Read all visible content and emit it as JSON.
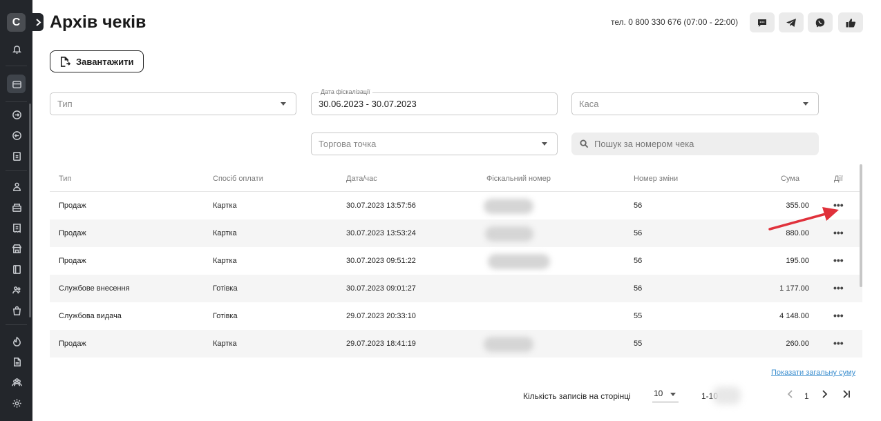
{
  "sidebar": {
    "logo": "C",
    "items": [
      "bell-icon",
      "card-icon",
      "login-icon",
      "logout-icon",
      "report-icon",
      "users-icon",
      "cashbox-icon",
      "receipt-icon",
      "store-icon",
      "book-icon",
      "people-icon",
      "bag-icon",
      "fire-icon",
      "document-icon",
      "team-icon",
      "gear-icon"
    ]
  },
  "header": {
    "title": "Архів чеків",
    "phone": "тел. 0 800 330 676 (07:00 - 22:00)",
    "buttons": [
      "chat-icon",
      "telegram-icon",
      "viber-icon",
      "thumbs-up-icon"
    ]
  },
  "toolbar": {
    "download_label": "Завантажити"
  },
  "filters": {
    "type_placeholder": "Тип",
    "date_label": "Дата фіскалізації",
    "date_value": "30.06.2023 - 30.07.2023",
    "cashbox_placeholder": "Каса",
    "outlet_placeholder": "Торгова точка",
    "search_placeholder": "Пошук за номером чека"
  },
  "table": {
    "columns": {
      "type": "Тип",
      "payment": "Спосіб оплати",
      "datetime": "Дата/час",
      "fiscal": "Фіскальний номер",
      "shift": "Номер зміни",
      "sum": "Сума",
      "actions": "Дії"
    },
    "rows": [
      {
        "type": "Продаж",
        "payment": "Картка",
        "datetime": "30.07.2023 13:57:56",
        "shift": "56",
        "sum": "355.00",
        "actions": "•••"
      },
      {
        "type": "Продаж",
        "payment": "Картка",
        "datetime": "30.07.2023 13:53:24",
        "shift": "56",
        "sum": "880.00",
        "actions": "•••"
      },
      {
        "type": "Продаж",
        "payment": "Картка",
        "datetime": "30.07.2023 09:51:22",
        "shift": "56",
        "sum": "195.00",
        "actions": "•••"
      },
      {
        "type": "Службове внесення",
        "payment": "Готівка",
        "datetime": "30.07.2023 09:01:27",
        "shift": "56",
        "sum": "1 177.00",
        "actions": "•••"
      },
      {
        "type": "Службова видача",
        "payment": "Готівка",
        "datetime": "29.07.2023 20:33:10",
        "shift": "55",
        "sum": "4 148.00",
        "actions": "•••"
      },
      {
        "type": "Продаж",
        "payment": "Картка",
        "datetime": "29.07.2023 18:41:19",
        "shift": "55",
        "sum": "260.00",
        "actions": "•••"
      }
    ]
  },
  "footer": {
    "show_total": "Показати загальну суму",
    "per_page_label": "Кількість записів на сторінці",
    "per_page_value": "10",
    "range": "1-10",
    "page": "1"
  },
  "colors": {
    "sidebar": "#23262b",
    "link": "#3d8fcf",
    "arrow": "#e0313b"
  }
}
